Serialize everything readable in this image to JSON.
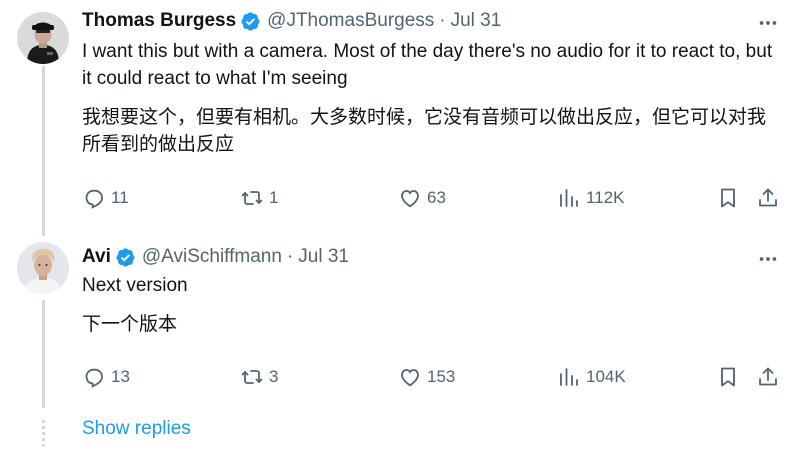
{
  "tweets": [
    {
      "display_name": "Thomas Burgess",
      "handle": "@JThomasBurgess",
      "date": "Jul 31",
      "text_en": "I want this but with a camera. Most of the day there's no audio for it to react to, but it could react to what I'm seeing",
      "text_cn": "我想要这个，但要有相机。大多数时候，它没有音频可以做出反应，但它可以对我所看到的做出反应",
      "replies": "11",
      "reposts": "1",
      "likes": "63",
      "views": "112K"
    },
    {
      "display_name": "Avi",
      "handle": "@AviSchiffmann",
      "date": "Jul 31",
      "text_en": "Next version",
      "text_cn": "下一个版本",
      "replies": "13",
      "reposts": "3",
      "likes": "153",
      "views": "104K"
    }
  ],
  "show_replies_label": "Show replies",
  "colors": {
    "verified": "#1d9bf0",
    "link": "#1d9bf0",
    "secondary_text": "#536471",
    "thread_line": "#cfd9de"
  },
  "icons": [
    "verified-badge-icon",
    "more-icon",
    "reply-icon",
    "repost-icon",
    "like-icon",
    "views-icon",
    "bookmark-icon",
    "share-icon"
  ]
}
